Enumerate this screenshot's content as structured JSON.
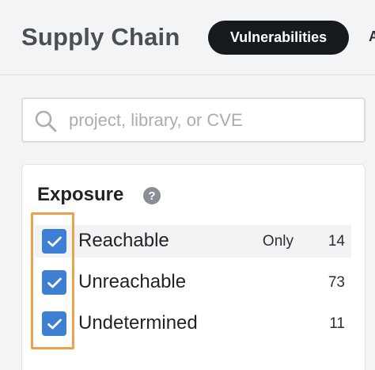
{
  "header": {
    "title": "Supply Chain",
    "active_tab": "Vulnerabilities",
    "next_tab_partial": "A"
  },
  "search": {
    "placeholder": "project, library, or CVE",
    "value": ""
  },
  "filter": {
    "title": "Exposure",
    "help_label": "?",
    "items": [
      {
        "label": "Reachable",
        "only_label": "Only",
        "count": "14",
        "checked": true
      },
      {
        "label": "Unreachable",
        "count": "73",
        "checked": true
      },
      {
        "label": "Undetermined",
        "count": "11",
        "checked": true
      }
    ]
  },
  "colors": {
    "checkbox": "#3e7fd4",
    "active_tab_bg": "#16191d",
    "annotation_outline": "#f0a04b"
  }
}
